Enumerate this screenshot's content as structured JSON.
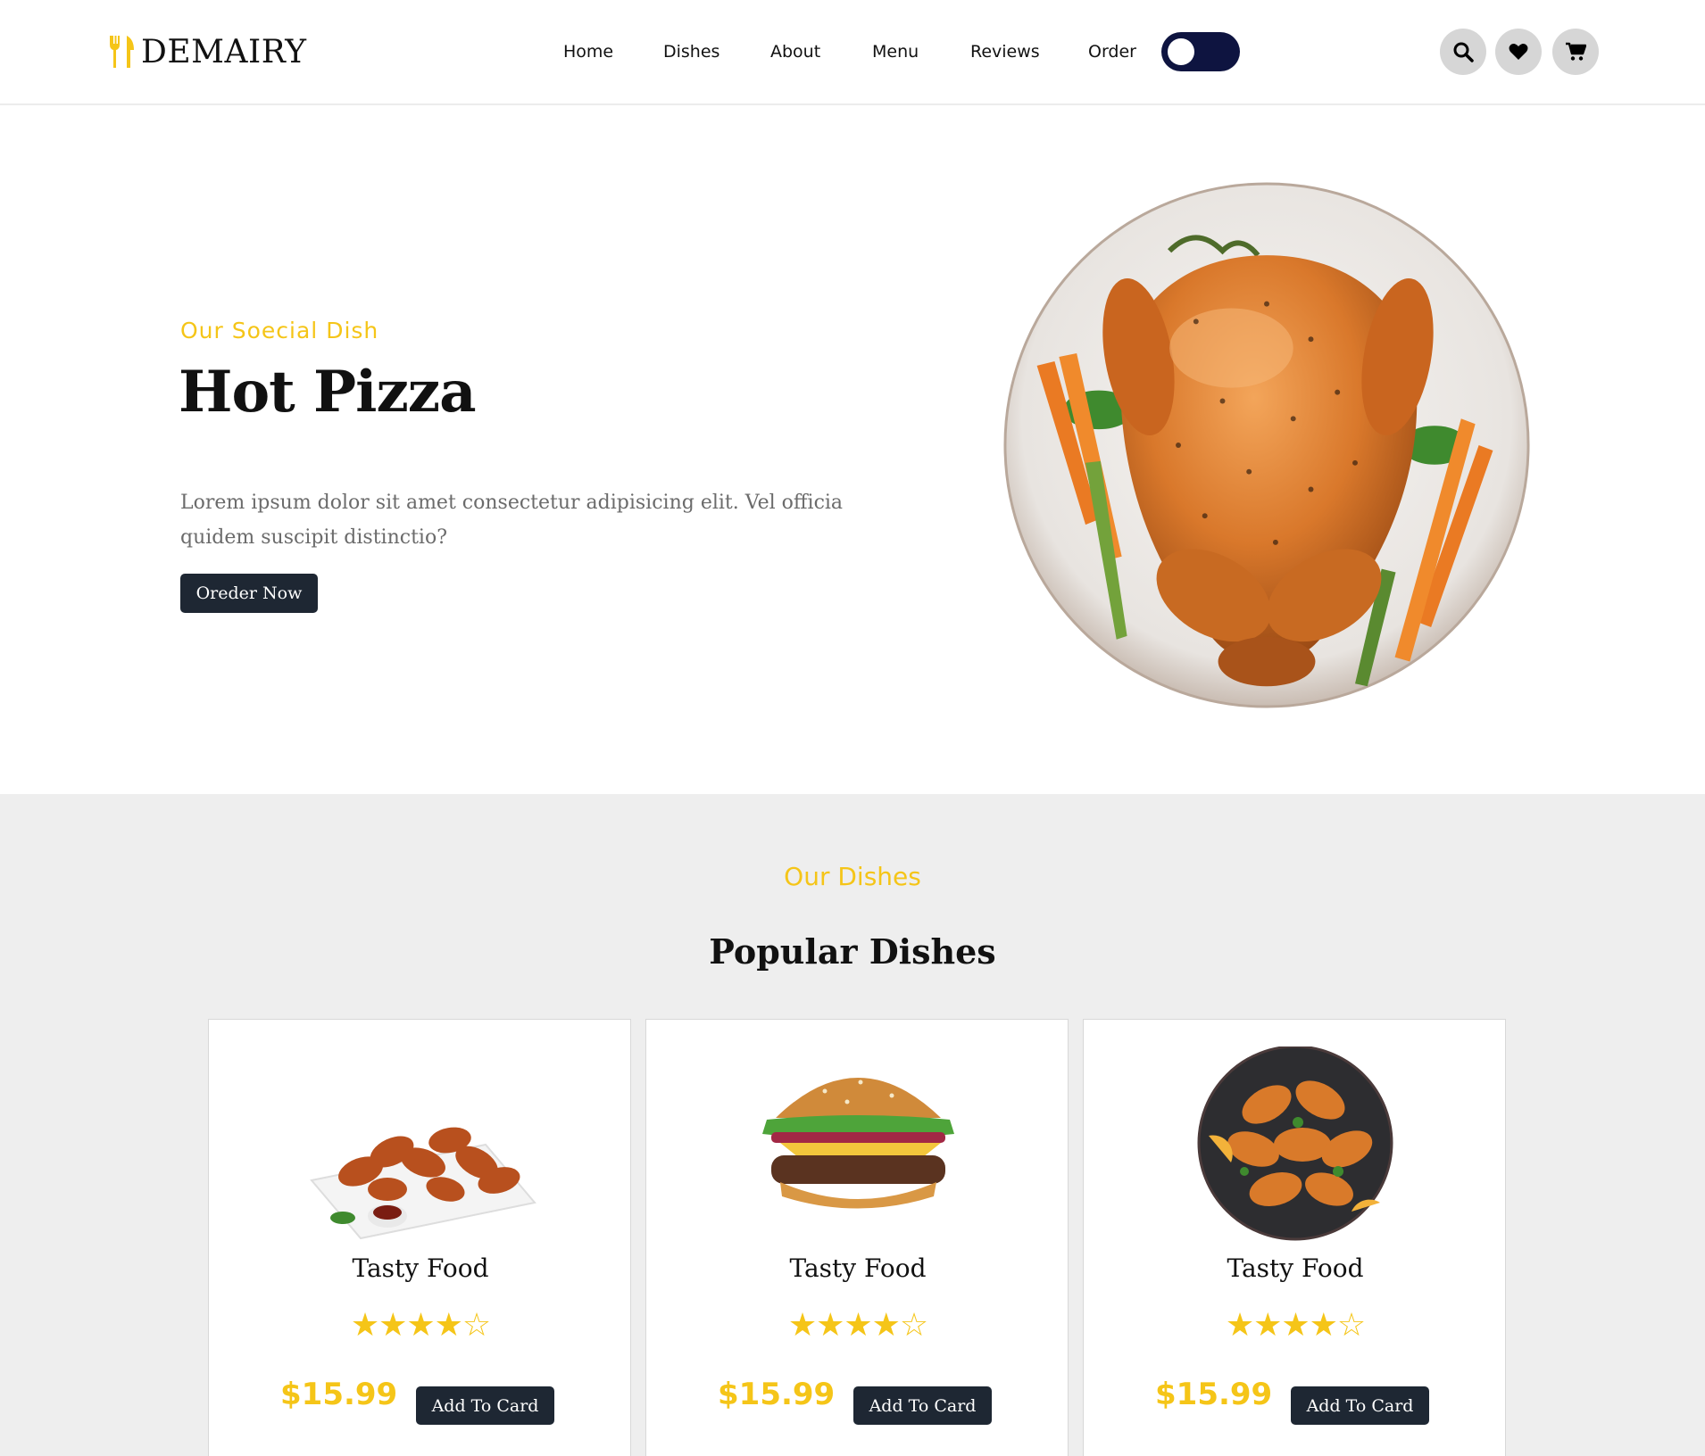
{
  "brand": {
    "name": "DEMAIRY",
    "accent_color": "#f5c518",
    "dark_color": "#1e2733"
  },
  "nav": {
    "items": [
      {
        "label": "Home"
      },
      {
        "label": "Dishes"
      },
      {
        "label": "About"
      },
      {
        "label": "Menu"
      },
      {
        "label": "Reviews"
      },
      {
        "label": "Order"
      }
    ],
    "theme_toggle": {
      "icon": "toggle-switch",
      "state": "off"
    },
    "actions": [
      {
        "icon": "search-icon"
      },
      {
        "icon": "heart-icon"
      },
      {
        "icon": "cart-icon"
      }
    ]
  },
  "hero": {
    "subtitle": "Our  Soecial  Dish",
    "title": "Hot Pizza",
    "description": "Lorem ipsum dolor sit amet consectetur adipisicing elit. Vel officia quidem suscipit distinctio?",
    "button_label": "Oreder Now",
    "image": "roast-chicken-plate"
  },
  "dishes": {
    "subtitle": "Our Dishes",
    "title": "Popular Dishes",
    "cards": [
      {
        "name": "Tasty Food",
        "rating": 4,
        "max_rating": 5,
        "stars": "★★★★☆",
        "price": "$15.99",
        "button_label": "Add To Card",
        "image": "chicken-wings-plate"
      },
      {
        "name": "Tasty Food",
        "rating": 4,
        "max_rating": 5,
        "stars": "★★★★☆",
        "price": "$15.99",
        "button_label": "Add To Card",
        "image": "cheeseburger"
      },
      {
        "name": "Tasty Food",
        "rating": 4,
        "max_rating": 5,
        "stars": "★★★★☆",
        "price": "$15.99",
        "button_label": "Add To Card",
        "image": "fried-chicken-bowl"
      }
    ]
  }
}
